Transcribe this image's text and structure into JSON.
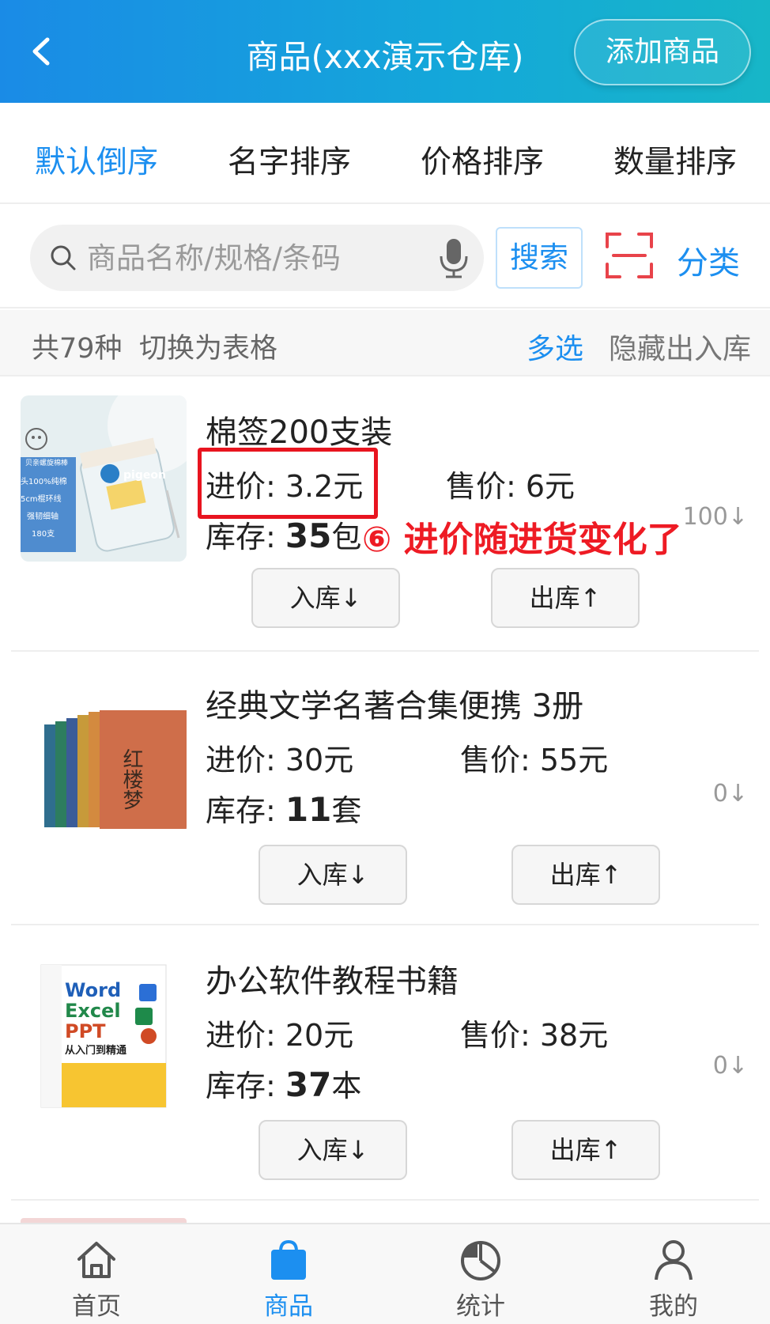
{
  "header": {
    "title": "商品(xxx演示仓库)",
    "add_button": "添加商品"
  },
  "sort_tabs": [
    {
      "label": "默认倒序",
      "active": true
    },
    {
      "label": "名字排序",
      "active": false
    },
    {
      "label": "价格排序",
      "active": false
    },
    {
      "label": "数量排序",
      "active": false
    }
  ],
  "search": {
    "placeholder": "商品名称/规格/条码",
    "button": "搜索",
    "category": "分类"
  },
  "summary": {
    "count": "共79种",
    "switch_view": "切换为表格",
    "multi_select": "多选",
    "hide_io": "隐藏出入库"
  },
  "products": [
    {
      "name": "棉签200支装",
      "cost": "进价: 3.2元",
      "price": "售价: 6元",
      "stock_label": "库存: ",
      "stock_num": "35",
      "stock_unit": "包",
      "side_count": "100↓",
      "in_button": "入库↓",
      "out_button": "出库↑",
      "annotation": "⑥ 进价随进货变化了"
    },
    {
      "name": "经典文学名著合集便携  3册",
      "cost": "进价: 30元",
      "price": "售价: 55元",
      "stock_label": "库存: ",
      "stock_num": "11",
      "stock_unit": "套",
      "side_count": "0↓",
      "in_button": "入库↓",
      "out_button": "出库↑"
    },
    {
      "name": "办公软件教程书籍",
      "cost": "进价: 20元",
      "price": "售价: 38元",
      "stock_label": "库存: ",
      "stock_num": "37",
      "stock_unit": "本",
      "side_count": "0↓",
      "in_button": "入库↓",
      "out_button": "出库↑"
    }
  ],
  "thumb_text": {
    "swab_brand": "pigeon",
    "swab_lines": [
      "贝亲螺旋棉棒",
      "头100%纯棉",
      "5cm棍环线",
      "强韧细轴",
      "180支"
    ],
    "book_title": "红楼梦",
    "office_lines": [
      "Word",
      "Excel",
      "PPT",
      "从入门到精通"
    ]
  },
  "tabbar": [
    {
      "label": "首页",
      "icon": "home-icon",
      "active": false
    },
    {
      "label": "商品",
      "icon": "shopping-bag-icon",
      "active": true
    },
    {
      "label": "统计",
      "icon": "pie-chart-icon",
      "active": false
    },
    {
      "label": "我的",
      "icon": "user-icon",
      "active": false
    }
  ],
  "colors": {
    "accent": "#1c8ff0",
    "annotation_red": "#ee1b24",
    "header_start": "#1a8be6",
    "header_end": "#17b6c7"
  }
}
